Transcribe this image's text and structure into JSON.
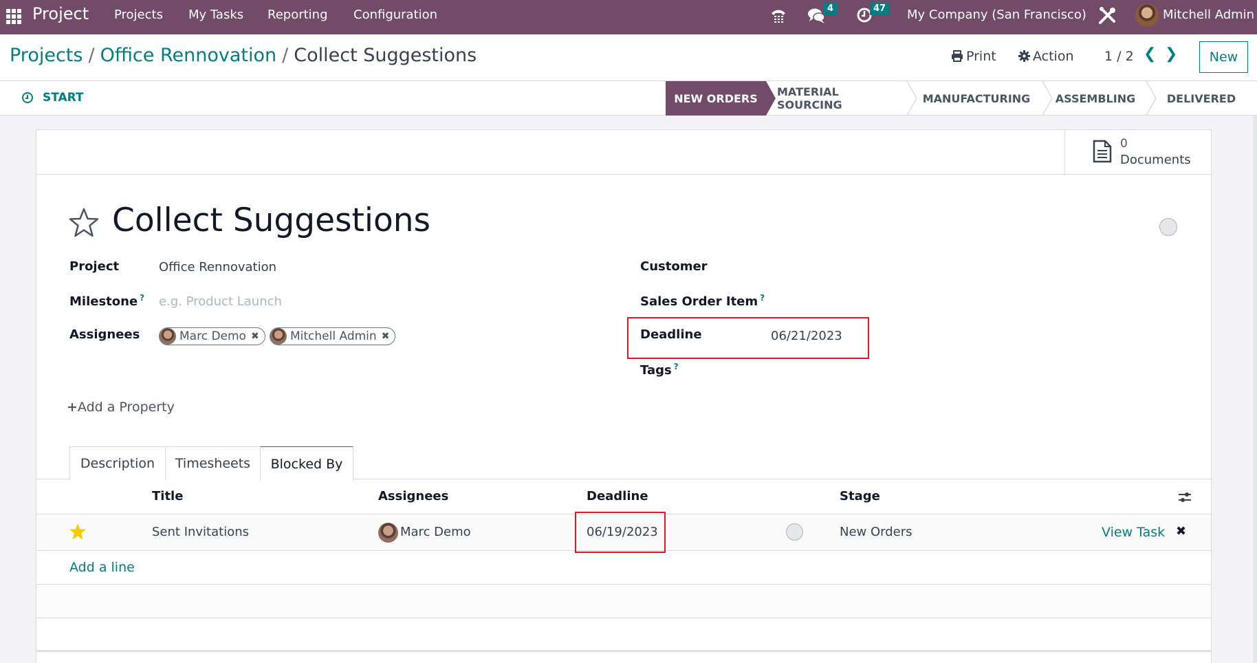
{
  "navbar": {
    "app_name": "Project",
    "menus": [
      "Projects",
      "My Tasks",
      "Reporting",
      "Configuration"
    ],
    "icons": [
      "phone-icon",
      "chat-icon",
      "activity-clock-icon",
      "debug-tools-icon"
    ],
    "messages_count": "4",
    "activities_count": "47",
    "company": "My Company (San Francisco)",
    "user": "Mitchell Admin"
  },
  "breadcrumb": {
    "items": [
      "Projects",
      "Office Rennovation"
    ],
    "current": "Collect Suggestions",
    "separator": "/"
  },
  "control_panel": {
    "print_label": "Print",
    "action_label": "Action",
    "pager": "1 / 2",
    "new_label": "New"
  },
  "statusbar": {
    "start_label": "START",
    "stages": [
      "NEW ORDERS",
      "MATERIAL SOURCING",
      "MANUFACTURING",
      "ASSEMBLING",
      "DELIVERED"
    ],
    "active_stage": "NEW ORDERS"
  },
  "smart_buttons": {
    "documents_count": "0",
    "documents_label": "Documents"
  },
  "form": {
    "title": "Collect Suggestions",
    "starred": false,
    "left_fields": {
      "project_label": "Project",
      "project_value": "Office Rennovation",
      "milestone_label": "Milestone",
      "milestone_placeholder": "e.g. Product Launch",
      "assignees_label": "Assignees",
      "assignees": [
        "Marc Demo",
        "Mitchell Admin"
      ]
    },
    "right_fields": {
      "customer_label": "Customer",
      "customer_value": "",
      "sales_order_item_label": "Sales Order Item",
      "deadline_label": "Deadline",
      "deadline_value": "06/21/2023",
      "tags_label": "Tags"
    },
    "help_mark": "?",
    "add_property_label": "Add a Property"
  },
  "tabs": {
    "items": [
      "Description",
      "Timesheets",
      "Blocked By"
    ],
    "active": "Blocked By"
  },
  "blocked_by": {
    "columns": [
      "Title",
      "Assignees",
      "Deadline",
      "Stage"
    ],
    "rows": [
      {
        "starred": true,
        "title": "Sent Invitations",
        "assignee": "Marc Demo",
        "deadline": "06/19/2023",
        "stage": "New Orders",
        "action_label": "View Task"
      }
    ],
    "add_line_label": "Add a line"
  },
  "colors": {
    "brand": "#714b67",
    "accent": "#017e84",
    "highlight": "#e0191f",
    "star_active": "#f3cc00"
  }
}
